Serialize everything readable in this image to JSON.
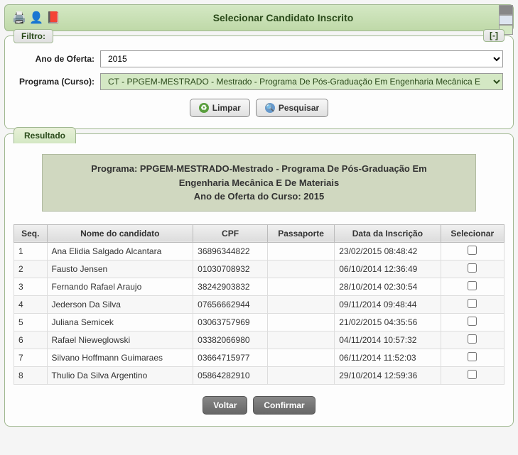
{
  "header": {
    "title": "Selecionar Candidato Inscrito"
  },
  "filter": {
    "tab_label": "Filtro:",
    "collapse_label": "[-]",
    "ano_label": "Ano de Oferta:",
    "ano_value": "2015",
    "programa_label": "Programa (Curso):",
    "programa_value": "CT - PPGEM-MESTRADO - Mestrado - Programa De Pós-Graduação Em Engenharia Mecânica E",
    "limpar_label": "Limpar",
    "pesquisar_label": "Pesquisar"
  },
  "result": {
    "tab_label": "Resultado",
    "banner_line1": "Programa: PPGEM-MESTRADO-Mestrado - Programa De Pós-Graduação Em",
    "banner_line2": "Engenharia Mecânica E De Materiais",
    "banner_line3": "Ano de Oferta do Curso: 2015",
    "columns": {
      "seq": "Seq.",
      "nome": "Nome do candidato",
      "cpf": "CPF",
      "passaporte": "Passaporte",
      "data": "Data da Inscrição",
      "selecionar": "Selecionar"
    },
    "rows": [
      {
        "seq": "1",
        "nome": "Ana Elidia Salgado Alcantara",
        "cpf": "36896344822",
        "passaporte": "",
        "data": "23/02/2015 08:48:42"
      },
      {
        "seq": "2",
        "nome": "Fausto Jensen",
        "cpf": "01030708932",
        "passaporte": "",
        "data": "06/10/2014 12:36:49"
      },
      {
        "seq": "3",
        "nome": "Fernando Rafael Araujo",
        "cpf": "38242903832",
        "passaporte": "",
        "data": "28/10/2014 02:30:54"
      },
      {
        "seq": "4",
        "nome": "Jederson Da Silva",
        "cpf": "07656662944",
        "passaporte": "",
        "data": "09/11/2014 09:48:44"
      },
      {
        "seq": "5",
        "nome": "Juliana Semicek",
        "cpf": "03063757969",
        "passaporte": "",
        "data": "21/02/2015 04:35:56"
      },
      {
        "seq": "6",
        "nome": "Rafael Nieweglowski",
        "cpf": "03382066980",
        "passaporte": "",
        "data": "04/11/2014 10:57:32"
      },
      {
        "seq": "7",
        "nome": "Silvano Hoffmann Guimaraes",
        "cpf": "03664715977",
        "passaporte": "",
        "data": "06/11/2014 11:52:03"
      },
      {
        "seq": "8",
        "nome": "Thulio Da Silva Argentino",
        "cpf": "05864282910",
        "passaporte": "",
        "data": "29/10/2014 12:59:36"
      }
    ],
    "voltar_label": "Voltar",
    "confirmar_label": "Confirmar"
  }
}
